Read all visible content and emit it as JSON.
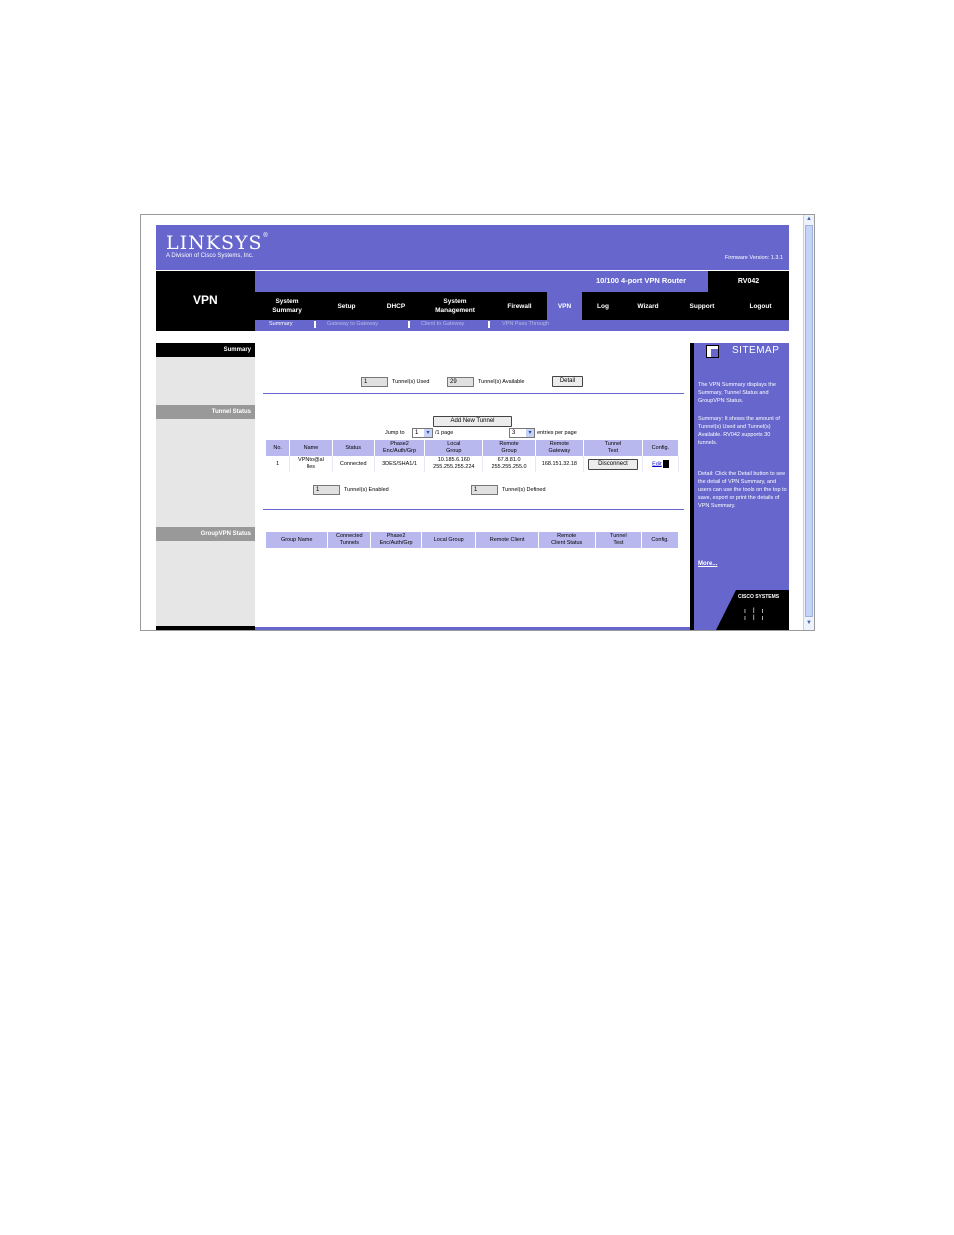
{
  "header": {
    "logo": "Linksys",
    "logo_sub": "A Division of Cisco Systems, Inc.",
    "firmware": "Firmware Version: 1.3.1",
    "section": "VPN",
    "product": "10/100 4-port VPN Router",
    "model": "RV042"
  },
  "tabs": [
    {
      "label": "System\nSummary"
    },
    {
      "label": "Setup"
    },
    {
      "label": "DHCP"
    },
    {
      "label": "System\nManagement"
    },
    {
      "label": "Firewall"
    },
    {
      "label": "VPN"
    },
    {
      "label": "Log"
    },
    {
      "label": "Wizard"
    },
    {
      "label": "Support"
    },
    {
      "label": "Logout"
    }
  ],
  "subtabs": [
    "Summary",
    "Gateway to Gateway",
    "Client to Gateway",
    "VPN Pass Through"
  ],
  "left": {
    "summary": "Summary",
    "tunnel_status": "Tunnel Status",
    "groupvpn_status": "GroupVPN Status"
  },
  "summary": {
    "tunnels_used_value": "1",
    "tunnels_used_label": "Tunnel(s) Used",
    "tunnels_available_value": "29",
    "tunnels_available_label": "Tunnel(s) Available",
    "detail_button": "Detail"
  },
  "tunnel": {
    "add_button": "Add New Tunnel",
    "jump_label": "Jump to",
    "jump_value": "1",
    "page_label": "/1 page",
    "entries_value": "3",
    "entries_label": "entries per page",
    "columns": [
      "No.",
      "Name",
      "Status",
      "Phase2\nEnc/Auth/Grp",
      "Local\nGroup",
      "Remote\nGroup",
      "Remote\nGateway",
      "Tunnel\nTest",
      "Config."
    ],
    "row": {
      "no": "1",
      "name": "VPNto@al\nlles",
      "status": "Connected",
      "phase2": "3DES/SHA1/1",
      "local_group": "10.185.6.160\n255.255.255.224",
      "remote_group": "67.8.81.0\n255.255.255.0",
      "remote_gateway": "168.151.32.18",
      "disconnect_button": "Disconnect",
      "edit_link": "Edit"
    },
    "enabled_value": "1",
    "enabled_label": "Tunnel(s) Enabled",
    "defined_value": "1",
    "defined_label": "Tunnel(s) Defined"
  },
  "groupvpn": {
    "columns": [
      "Group Name",
      "Connected\nTunnels",
      "Phase2\nEnc/Auth/Grp",
      "Local Group",
      "Remote Client",
      "Remote\nClient Status",
      "Tunnel\nTest",
      "Config."
    ]
  },
  "sitemap": {
    "title": "SITEMAP",
    "p1": "The VPN Summary displays the Summary, Tunnel Status and GroupVPN Status.",
    "p2": "Summary: It shows the amount of Tunnel(s) Used and Tunnel(s) Available. RV042 supports 30 tunnels.",
    "p3": "Detail: Click the Detail button to see the detail of VPN Summary, and users can use the tools on the top to save, export or print the details of VPN Summary.",
    "more": "More...",
    "cisco": "Cisco Systems"
  },
  "colors": {
    "brand": "#6666cc",
    "header_black": "#000000",
    "table_header": "#b8b8ee"
  }
}
